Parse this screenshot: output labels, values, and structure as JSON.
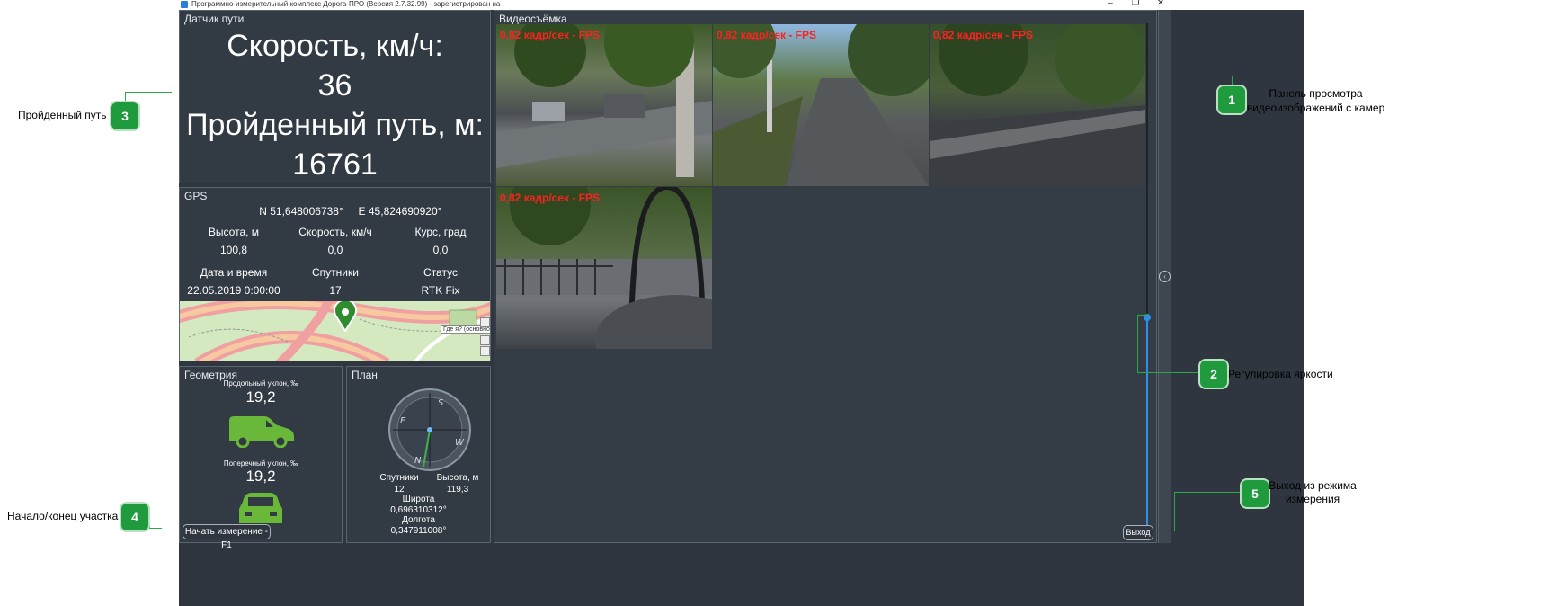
{
  "window": {
    "title": "Программно-измерительный комплекс Дорога-ПРО (Версия 2.7.32.99) - зарегистрирован на",
    "controls": [
      "–",
      "❐",
      "✕"
    ]
  },
  "path_sensor": {
    "title": "Датчик пути",
    "speed_label": "Скорость, км/ч:",
    "speed_value": "36",
    "distance_label": "Пройденный путь, м:",
    "distance_value": "16761"
  },
  "gps": {
    "title": "GPS",
    "lat": "N  51,648006738°",
    "lon": "E 45,824690920°",
    "fields": [
      {
        "label": "Высота, м",
        "value": "100,8"
      },
      {
        "label": "Скорость, км/ч",
        "value": "0,0"
      },
      {
        "label": "Курс, град",
        "value": "0,0"
      },
      {
        "label": "Дата и время",
        "value": "22.05.2019 0:00:00"
      },
      {
        "label": "Спутники",
        "value": "17"
      },
      {
        "label": "Статус",
        "value": "RTK Fix"
      }
    ],
    "map_tooltip": "Где я? (основной GPS)"
  },
  "geometry": {
    "title": "Геометрия",
    "long_slope_label": "Продольный уклон, ‰",
    "long_slope_value": "19,2",
    "cross_slope_label": "Поперечный уклон, ‰",
    "cross_slope_value": "19,2",
    "start_button": "Начать измерение - F1"
  },
  "plan": {
    "title": "План",
    "compass_letters": [
      "S",
      "W",
      "N",
      "E"
    ],
    "sat_label": "Спутники",
    "sat_value": "12",
    "alt_label": "Высота, м",
    "alt_value": "119,3",
    "lat_label": "Широта",
    "lat_value": "0,696310312°",
    "lon_label": "Долгота",
    "lon_value": "0,347911008°"
  },
  "video": {
    "title": "Видеосъёмка",
    "cameras": [
      {
        "fps": "0,82 кадр/сек - FPS"
      },
      {
        "fps": "0,82 кадр/сек - FPS"
      },
      {
        "fps": "0,82 кадр/сек - FPS"
      },
      {
        "fps": "0,82 кадр/сек - FPS"
      }
    ],
    "exit_button": "Выход",
    "brightness_level": 0.0
  },
  "annotations": [
    {
      "num": "1",
      "text_line1": "Панель просмотра",
      "text_line2": "видеоизображений с камер"
    },
    {
      "num": "2",
      "text_line1": "Регулировка яркости"
    },
    {
      "num": "3",
      "text_line1": "Пройденный путь"
    },
    {
      "num": "4",
      "text_line1": "Начало/конец участка"
    },
    {
      "num": "5",
      "text_line1": "Выход из режима",
      "text_line2": "измерения"
    }
  ],
  "colors": {
    "panel_bg": "#323a44",
    "badge": "#1f9a3d",
    "fps_red": "#ff2020",
    "slider_blue": "#2f8fe8",
    "car_green": "#6ab83a"
  }
}
